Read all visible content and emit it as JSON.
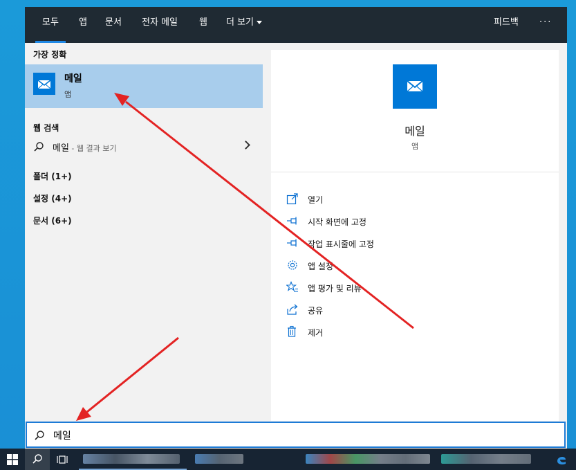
{
  "tabs": [
    {
      "label": "모두",
      "active": true
    },
    {
      "label": "앱"
    },
    {
      "label": "문서"
    },
    {
      "label": "전자 메일"
    },
    {
      "label": "웹"
    },
    {
      "label": "더 보기"
    }
  ],
  "topbar": {
    "feedback": "피드백",
    "more": "···"
  },
  "left": {
    "best_match_heading": "가장 정확",
    "best_match": {
      "title": "메일",
      "subtitle": "앱"
    },
    "web_heading": "웹 검색",
    "web_result": {
      "query": "메일",
      "hint": " - 웹 결과 보기"
    },
    "categories": [
      "폴더 (1+)",
      "설정 (4+)",
      "문서 (6+)"
    ]
  },
  "right": {
    "title": "메일",
    "subtitle": "앱",
    "actions": [
      {
        "label": "열기",
        "icon": "open-icon"
      },
      {
        "label": "시작 화면에 고정",
        "icon": "pin-icon"
      },
      {
        "label": "작업 표시줄에 고정",
        "icon": "pin-icon"
      },
      {
        "label": "앱 설정",
        "icon": "gear-icon"
      },
      {
        "label": "앱 평가 및 리뷰",
        "icon": "star-icon"
      },
      {
        "label": "공유",
        "icon": "share-icon"
      },
      {
        "label": "제거",
        "icon": "trash-icon"
      }
    ]
  },
  "search": {
    "value": "메일"
  },
  "colors": {
    "accent": "#0078d7",
    "highlight": "#a8cdec",
    "topbar": "#1f2a33",
    "annotation": "#e32323"
  }
}
